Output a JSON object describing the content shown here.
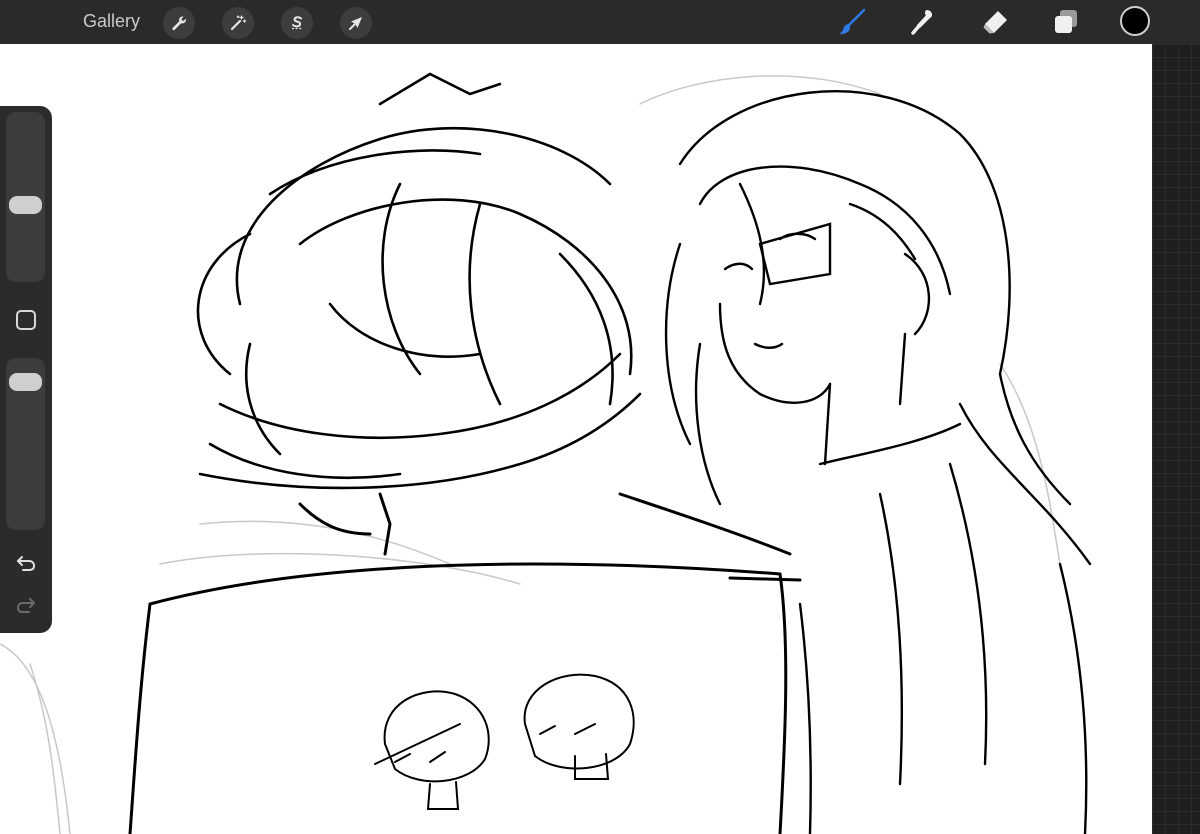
{
  "topbar": {
    "gallery_label": "Gallery",
    "left_tools": [
      {
        "icon": "wrench-icon",
        "name": "actions-button"
      },
      {
        "icon": "magic-wand-icon",
        "name": "adjustments-button"
      },
      {
        "icon": "s-selection-icon",
        "name": "selection-button"
      },
      {
        "icon": "arrow-cursor-icon",
        "name": "transform-button"
      }
    ],
    "right_tools": [
      {
        "icon": "brush-icon",
        "name": "brush-tool-button",
        "active": true
      },
      {
        "icon": "smudge-icon",
        "name": "smudge-tool-button"
      },
      {
        "icon": "eraser-icon",
        "name": "eraser-tool-button"
      },
      {
        "icon": "layers-icon",
        "name": "layers-button"
      }
    ],
    "color_well": "#000000"
  },
  "sidebar": {
    "brush_size": 0.45,
    "opacity": 0.9,
    "modify_button_icon": "square-icon",
    "undo_icon": "undo-icon",
    "redo_icon": "redo-icon"
  },
  "colors": {
    "toolbar_bg": "#2a2a2a",
    "accent_active": "#2f7be5",
    "canvas_bg": "#ffffff",
    "ink": "#000000"
  }
}
